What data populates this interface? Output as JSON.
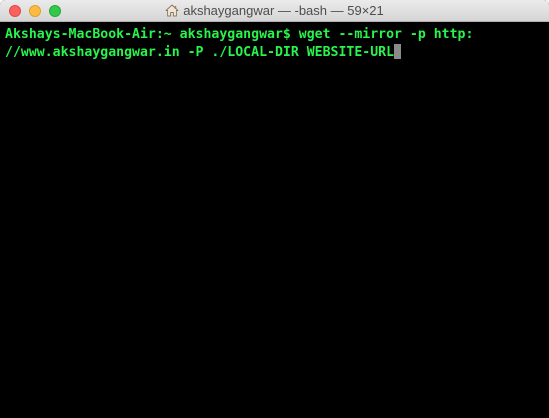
{
  "window": {
    "title": "akshaygangwar — -bash — 59×21",
    "title_icon": "home-icon",
    "traffic_lights": {
      "close_color": "#fc605c",
      "minimize_color": "#fdbc40",
      "zoom_color": "#34c84a"
    }
  },
  "terminal": {
    "background": "#000000",
    "text_color": "#29f34c",
    "lines": [
      "Akshays-MacBook-Air:~ akshaygangwar$ wget --mirror -p http:",
      "//www.akshaygangwar.in -P ./LOCAL-DIR WEBSITE-URL"
    ]
  }
}
